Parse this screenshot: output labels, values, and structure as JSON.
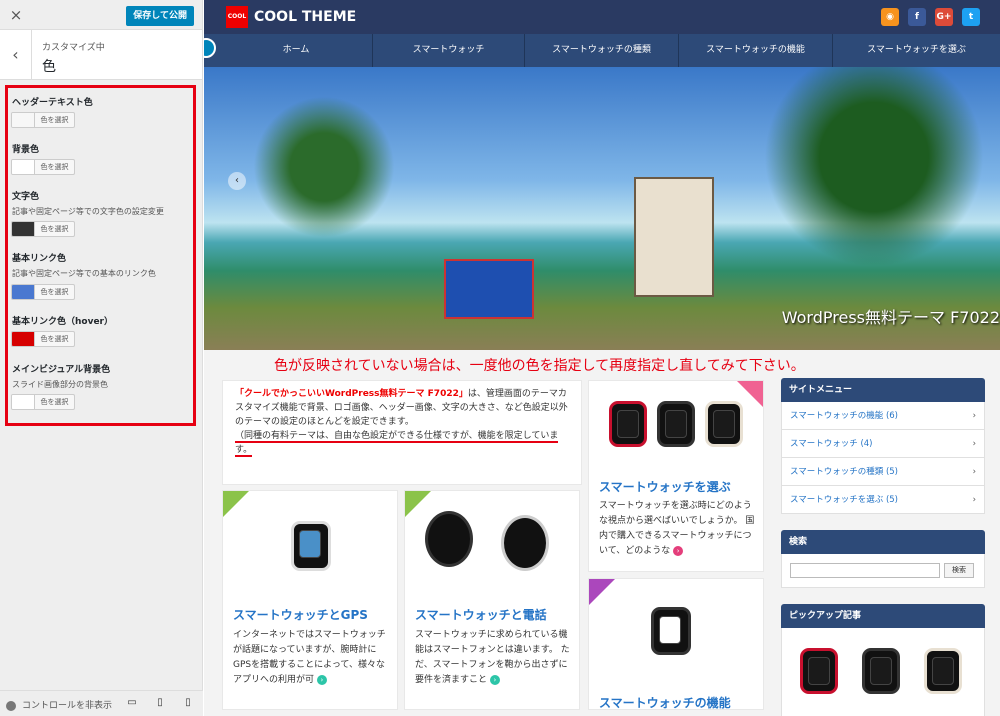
{
  "customizer": {
    "close_icon": "×",
    "save_label": "保存して公開",
    "back_icon": "‹",
    "breadcrumb": "カスタマイズ中",
    "section_title": "色",
    "controls": [
      {
        "title": "ヘッダーテキスト色",
        "desc": "",
        "button": "色を選択",
        "color": "#f7f7f7"
      },
      {
        "title": "背景色",
        "desc": "",
        "button": "色を選択",
        "color": "#ffffff"
      },
      {
        "title": "文字色",
        "desc": "記事や固定ページ等での文字色の設定変更",
        "button": "色を選択",
        "color": "#333333"
      },
      {
        "title": "基本リンク色",
        "desc": "記事や固定ページ等での基本のリンク色",
        "button": "色を選択",
        "color": "#4a78d0"
      },
      {
        "title": "基本リンク色（hover）",
        "desc": "",
        "button": "色を選択",
        "color": "#d60000"
      },
      {
        "title": "メインビジュアル背景色",
        "desc": "スライド画像部分の背景色",
        "button": "色を選択",
        "color": "#ffffff"
      }
    ],
    "footer": {
      "hide_label": "コントロールを非表示"
    }
  },
  "site": {
    "logo_text": "COOL",
    "title": "COOL THEME",
    "social": [
      {
        "icon": "rss-icon",
        "glyph": "◉",
        "color": "#f7931e"
      },
      {
        "icon": "facebook-icon",
        "glyph": "f",
        "color": "#3b5998"
      },
      {
        "icon": "google-plus-icon",
        "glyph": "G+",
        "color": "#dd4b39"
      },
      {
        "icon": "twitter-icon",
        "glyph": "t",
        "color": "#1da1f2"
      }
    ],
    "nav": [
      "ホーム",
      "スマートウォッチ",
      "スマートウォッチの種類",
      "スマートウォッチの機能",
      "スマートウォッチを選ぶ"
    ],
    "hero_caption": "WordPress無料テーマ F7022",
    "notice": "色が反映されていない場合は、一度他の色を指定して再度指定し直してみて下さい。",
    "intro": {
      "quote": "「クールでかっこいいWordPress無料テーマ F7022」",
      "body": "は、管理画面のテーマカスタマイズ機能で背景、ロゴ画像、ヘッダー画像、文字の大きさ、など色設定以外のテーマの設定のほとんどを設定できます。",
      "note": "（同種の有料テーマは、自由な色設定ができる仕様ですが、機能を限定しています。"
    },
    "cards": [
      {
        "title": "スマートウォッチを選ぶ",
        "desc": "スマートウォッチを選ぶ時にどのような視点から選べばいいでしょうか。 国内で購入できるスマートウォッチについて、どのような"
      },
      {
        "title": "スマートウォッチとGPS",
        "desc": "インターネットではスマートウォッチが話題になっていますが、腕時計にGPSを搭載することによって、様々なアプリへの利用が可"
      },
      {
        "title": "スマートウォッチと電話",
        "desc": "スマートウォッチに求められている機能はスマートフォンとは違います。 ただ、スマートフォンを鞄から出さずに要件を済ますこと"
      },
      {
        "title": "スマートウォッチの機能",
        "desc": ""
      }
    ],
    "sidebar": {
      "menu_title": "サイトメニュー",
      "menu": [
        "スマートウォッチの機能 (6)",
        "スマートウォッチ (4)",
        "スマートウォッチの種類 (5)",
        "スマートウォッチを選ぶ (5)"
      ],
      "search_title": "検索",
      "search_button": "検索",
      "pickup_title": "ピックアップ記事"
    }
  }
}
